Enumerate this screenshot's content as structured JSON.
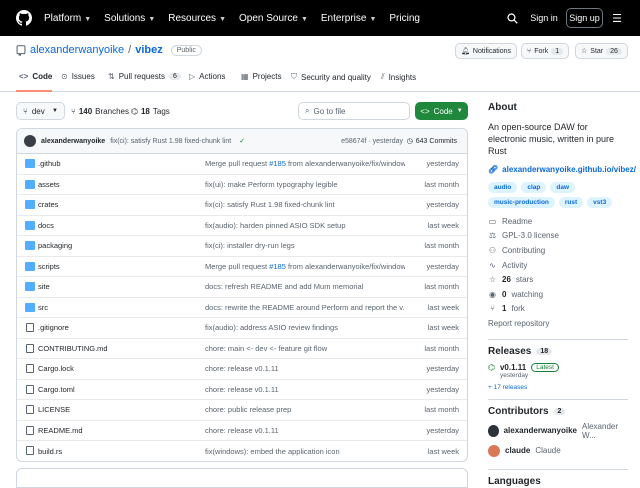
{
  "nav": {
    "platform": "Platform",
    "solutions": "Solutions",
    "resources": "Resources",
    "open_source": "Open Source",
    "enterprise": "Enterprise",
    "pricing": "Pricing",
    "sign_in": "Sign in",
    "sign_up": "Sign up"
  },
  "repo": {
    "owner": "alexanderwanyoike",
    "sep": "/",
    "name": "vibez",
    "visibility": "Public",
    "notifications": "Notifications",
    "fork": "Fork",
    "fork_count": "1",
    "star": "Star",
    "star_count": "26"
  },
  "tabs": {
    "code": "Code",
    "issues": "Issues",
    "pulls": "Pull requests",
    "pulls_count": "6",
    "actions": "Actions",
    "projects": "Projects",
    "security": "Security and quality",
    "insights": "Insights"
  },
  "toolbar": {
    "branch": "dev",
    "branches_count": "140",
    "branches_label": "Branches",
    "tags_count": "18",
    "tags_label": "Tags",
    "search_placeholder": "Go to file",
    "code_button": "Code"
  },
  "commit": {
    "author": "alexanderwanyoike",
    "message": "fix(ci): satisfy Rust 1.98 fixed-chunk lint",
    "hash": "e58674f",
    "time": "yesterday",
    "commits": "643 Commits"
  },
  "files": [
    {
      "type": "dir",
      "name": ".github",
      "msg_pre": "Merge pull request ",
      "msg_link": "#185",
      "msg_post": " from alexanderwanyoike/fix/window...",
      "date": "yesterday"
    },
    {
      "type": "dir",
      "name": "assets",
      "msg_pre": "fix(ui): make Perform typography legible",
      "msg_link": "",
      "msg_post": "",
      "date": "last month"
    },
    {
      "type": "dir",
      "name": "crates",
      "msg_pre": "fix(ci): satisfy Rust 1.98 fixed-chunk lint",
      "msg_link": "",
      "msg_post": "",
      "date": "yesterday"
    },
    {
      "type": "dir",
      "name": "docs",
      "msg_pre": "fix(audio): harden pinned ASIO SDK setup",
      "msg_link": "",
      "msg_post": "",
      "date": "last week"
    },
    {
      "type": "dir",
      "name": "packaging",
      "msg_pre": "fix(ci): installer dry-run legs",
      "msg_link": "",
      "msg_post": "",
      "date": "last month"
    },
    {
      "type": "dir",
      "name": "scripts",
      "msg_pre": "Merge pull request ",
      "msg_link": "#185",
      "msg_post": " from alexanderwanyoike/fix/window...",
      "date": "yesterday"
    },
    {
      "type": "dir",
      "name": "site",
      "msg_pre": "docs: refresh README and add Mum memorial",
      "msg_link": "",
      "msg_post": "",
      "date": "last month"
    },
    {
      "type": "dir",
      "name": "src",
      "msg_pre": "docs: rewrite the README around Perform and report the v...",
      "msg_link": "",
      "msg_post": "",
      "date": "last week"
    },
    {
      "type": "file",
      "name": ".gitignore",
      "msg_pre": "fix(audio): address ASIO review findings",
      "msg_link": "",
      "msg_post": "",
      "date": "last week"
    },
    {
      "type": "file",
      "name": "CONTRIBUTING.md",
      "msg_pre": "chore: main <- dev <- feature git flow",
      "msg_link": "",
      "msg_post": "",
      "date": "last month"
    },
    {
      "type": "file",
      "name": "Cargo.lock",
      "msg_pre": "chore: release v0.1.11",
      "msg_link": "",
      "msg_post": "",
      "date": "yesterday"
    },
    {
      "type": "file",
      "name": "Cargo.toml",
      "msg_pre": "chore: release v0.1.11",
      "msg_link": "",
      "msg_post": "",
      "date": "yesterday"
    },
    {
      "type": "file",
      "name": "LICENSE",
      "msg_pre": "chore: public release prep",
      "msg_link": "",
      "msg_post": "",
      "date": "last month"
    },
    {
      "type": "file",
      "name": "README.md",
      "msg_pre": "chore: release v0.1.11",
      "msg_link": "",
      "msg_post": "",
      "date": "yesterday"
    },
    {
      "type": "file",
      "name": "build.rs",
      "msg_pre": "fix(windows): embed the application icon",
      "msg_link": "",
      "msg_post": "",
      "date": "last week"
    }
  ],
  "about": {
    "title": "About",
    "description": "An open-source DAW for electronic music, written in pure Rust",
    "website": "alexanderwanyoike.github.io/vibez/",
    "topics": [
      "audio",
      "clap",
      "daw",
      "music-production",
      "rust",
      "vst3"
    ],
    "readme": "Readme",
    "license": "GPL-3.0 license",
    "contributing": "Contributing",
    "activity": "Activity",
    "stars_count": "26",
    "stars_label": "stars",
    "watching_count": "0",
    "watching_label": "watching",
    "forks_count": "1",
    "forks_label": "fork",
    "report": "Report repository"
  },
  "releases": {
    "title": "Releases",
    "count": "18",
    "version": "v0.1.11",
    "latest": "Latest",
    "date": "yesterday",
    "more": "+ 17 releases"
  },
  "contributors": {
    "title": "Contributors",
    "count": "2",
    "list": [
      {
        "login": "alexanderwanyoike",
        "name": "Alexander W..."
      },
      {
        "login": "claude",
        "name": "Claude"
      }
    ]
  },
  "languages": {
    "title": "Languages"
  }
}
